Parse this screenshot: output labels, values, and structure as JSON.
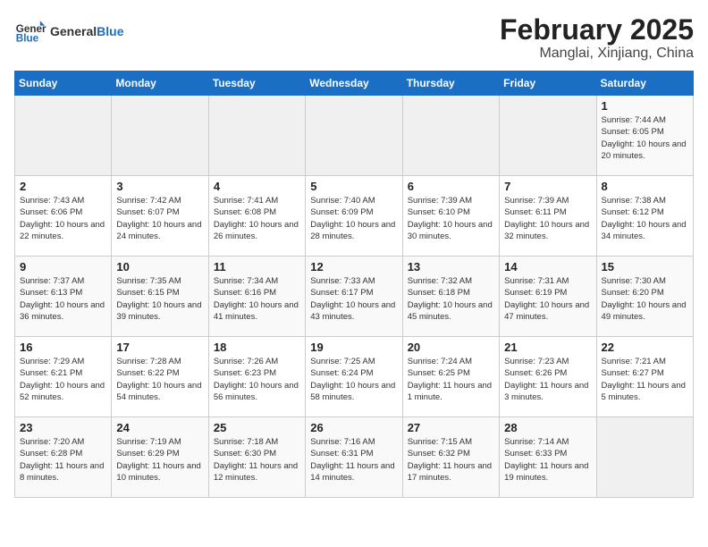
{
  "header": {
    "logo_general": "General",
    "logo_blue": "Blue",
    "title": "February 2025",
    "subtitle": "Manglai, Xinjiang, China"
  },
  "calendar": {
    "days_of_week": [
      "Sunday",
      "Monday",
      "Tuesday",
      "Wednesday",
      "Thursday",
      "Friday",
      "Saturday"
    ],
    "weeks": [
      [
        {
          "day": "",
          "info": ""
        },
        {
          "day": "",
          "info": ""
        },
        {
          "day": "",
          "info": ""
        },
        {
          "day": "",
          "info": ""
        },
        {
          "day": "",
          "info": ""
        },
        {
          "day": "",
          "info": ""
        },
        {
          "day": "1",
          "info": "Sunrise: 7:44 AM\nSunset: 6:05 PM\nDaylight: 10 hours and 20 minutes."
        }
      ],
      [
        {
          "day": "2",
          "info": "Sunrise: 7:43 AM\nSunset: 6:06 PM\nDaylight: 10 hours and 22 minutes."
        },
        {
          "day": "3",
          "info": "Sunrise: 7:42 AM\nSunset: 6:07 PM\nDaylight: 10 hours and 24 minutes."
        },
        {
          "day": "4",
          "info": "Sunrise: 7:41 AM\nSunset: 6:08 PM\nDaylight: 10 hours and 26 minutes."
        },
        {
          "day": "5",
          "info": "Sunrise: 7:40 AM\nSunset: 6:09 PM\nDaylight: 10 hours and 28 minutes."
        },
        {
          "day": "6",
          "info": "Sunrise: 7:39 AM\nSunset: 6:10 PM\nDaylight: 10 hours and 30 minutes."
        },
        {
          "day": "7",
          "info": "Sunrise: 7:39 AM\nSunset: 6:11 PM\nDaylight: 10 hours and 32 minutes."
        },
        {
          "day": "8",
          "info": "Sunrise: 7:38 AM\nSunset: 6:12 PM\nDaylight: 10 hours and 34 minutes."
        }
      ],
      [
        {
          "day": "9",
          "info": "Sunrise: 7:37 AM\nSunset: 6:13 PM\nDaylight: 10 hours and 36 minutes."
        },
        {
          "day": "10",
          "info": "Sunrise: 7:35 AM\nSunset: 6:15 PM\nDaylight: 10 hours and 39 minutes."
        },
        {
          "day": "11",
          "info": "Sunrise: 7:34 AM\nSunset: 6:16 PM\nDaylight: 10 hours and 41 minutes."
        },
        {
          "day": "12",
          "info": "Sunrise: 7:33 AM\nSunset: 6:17 PM\nDaylight: 10 hours and 43 minutes."
        },
        {
          "day": "13",
          "info": "Sunrise: 7:32 AM\nSunset: 6:18 PM\nDaylight: 10 hours and 45 minutes."
        },
        {
          "day": "14",
          "info": "Sunrise: 7:31 AM\nSunset: 6:19 PM\nDaylight: 10 hours and 47 minutes."
        },
        {
          "day": "15",
          "info": "Sunrise: 7:30 AM\nSunset: 6:20 PM\nDaylight: 10 hours and 49 minutes."
        }
      ],
      [
        {
          "day": "16",
          "info": "Sunrise: 7:29 AM\nSunset: 6:21 PM\nDaylight: 10 hours and 52 minutes."
        },
        {
          "day": "17",
          "info": "Sunrise: 7:28 AM\nSunset: 6:22 PM\nDaylight: 10 hours and 54 minutes."
        },
        {
          "day": "18",
          "info": "Sunrise: 7:26 AM\nSunset: 6:23 PM\nDaylight: 10 hours and 56 minutes."
        },
        {
          "day": "19",
          "info": "Sunrise: 7:25 AM\nSunset: 6:24 PM\nDaylight: 10 hours and 58 minutes."
        },
        {
          "day": "20",
          "info": "Sunrise: 7:24 AM\nSunset: 6:25 PM\nDaylight: 11 hours and 1 minute."
        },
        {
          "day": "21",
          "info": "Sunrise: 7:23 AM\nSunset: 6:26 PM\nDaylight: 11 hours and 3 minutes."
        },
        {
          "day": "22",
          "info": "Sunrise: 7:21 AM\nSunset: 6:27 PM\nDaylight: 11 hours and 5 minutes."
        }
      ],
      [
        {
          "day": "23",
          "info": "Sunrise: 7:20 AM\nSunset: 6:28 PM\nDaylight: 11 hours and 8 minutes."
        },
        {
          "day": "24",
          "info": "Sunrise: 7:19 AM\nSunset: 6:29 PM\nDaylight: 11 hours and 10 minutes."
        },
        {
          "day": "25",
          "info": "Sunrise: 7:18 AM\nSunset: 6:30 PM\nDaylight: 11 hours and 12 minutes."
        },
        {
          "day": "26",
          "info": "Sunrise: 7:16 AM\nSunset: 6:31 PM\nDaylight: 11 hours and 14 minutes."
        },
        {
          "day": "27",
          "info": "Sunrise: 7:15 AM\nSunset: 6:32 PM\nDaylight: 11 hours and 17 minutes."
        },
        {
          "day": "28",
          "info": "Sunrise: 7:14 AM\nSunset: 6:33 PM\nDaylight: 11 hours and 19 minutes."
        },
        {
          "day": "",
          "info": ""
        }
      ]
    ]
  }
}
